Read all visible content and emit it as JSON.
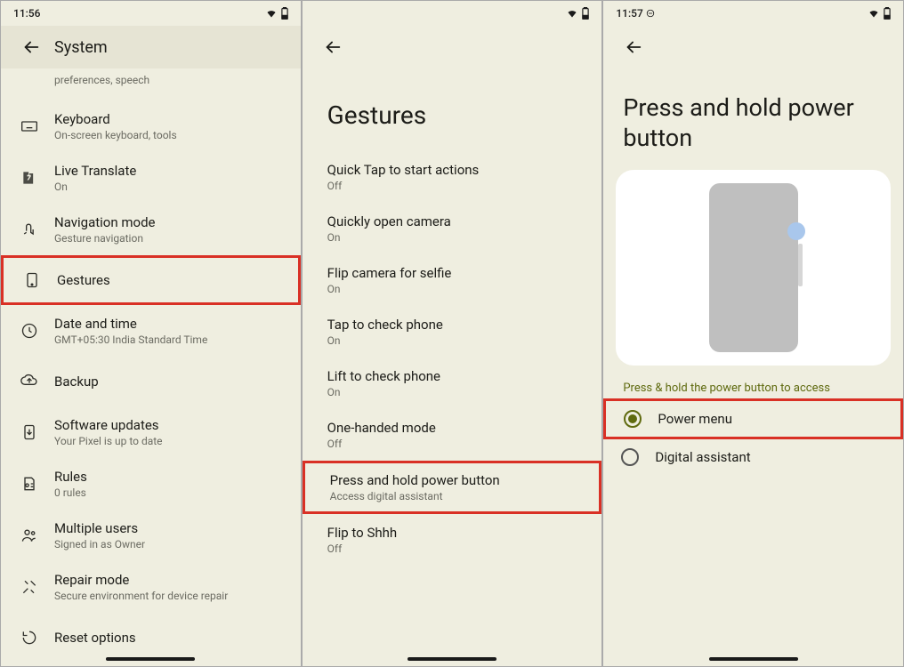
{
  "panel1": {
    "time": "11:56",
    "title": "System",
    "truncated_sub": "preferences, speech",
    "items": [
      {
        "title": "Keyboard",
        "sub": "On-screen keyboard, tools",
        "icon": "keyboard"
      },
      {
        "title": "Live Translate",
        "sub": "On",
        "icon": "translate"
      },
      {
        "title": "Navigation mode",
        "sub": "Gesture navigation",
        "icon": "navigation"
      },
      {
        "title": "Gestures",
        "sub": "",
        "icon": "gesture",
        "highlight": true
      },
      {
        "title": "Date and time",
        "sub": "GMT+05:30 India Standard Time",
        "icon": "clock"
      },
      {
        "title": "Backup",
        "sub": "",
        "icon": "backup"
      },
      {
        "title": "Software updates",
        "sub": "Your Pixel is up to date",
        "icon": "update"
      },
      {
        "title": "Rules",
        "sub": "0 rules",
        "icon": "rules"
      },
      {
        "title": "Multiple users",
        "sub": "Signed in as Owner",
        "icon": "users"
      },
      {
        "title": "Repair mode",
        "sub": "Secure environment for device repair",
        "icon": "repair"
      },
      {
        "title": "Reset options",
        "sub": "",
        "icon": "reset"
      }
    ]
  },
  "panel2": {
    "time": "",
    "title": "Gestures",
    "items": [
      {
        "title": "Quick Tap to start actions",
        "sub": "Off"
      },
      {
        "title": "Quickly open camera",
        "sub": "On"
      },
      {
        "title": "Flip camera for selfie",
        "sub": "On"
      },
      {
        "title": "Tap to check phone",
        "sub": "On"
      },
      {
        "title": "Lift to check phone",
        "sub": "On"
      },
      {
        "title": "One-handed mode",
        "sub": "Off"
      },
      {
        "title": "Press and hold power button",
        "sub": "Access digital assistant",
        "highlight": true
      },
      {
        "title": "Flip to Shhh",
        "sub": "Off"
      }
    ]
  },
  "panel3": {
    "time": "11:57",
    "title": "Press and hold power button",
    "caption": "Press & hold the power button to access",
    "options": [
      {
        "label": "Power menu",
        "selected": true,
        "highlight": true
      },
      {
        "label": "Digital assistant",
        "selected": false
      }
    ]
  }
}
